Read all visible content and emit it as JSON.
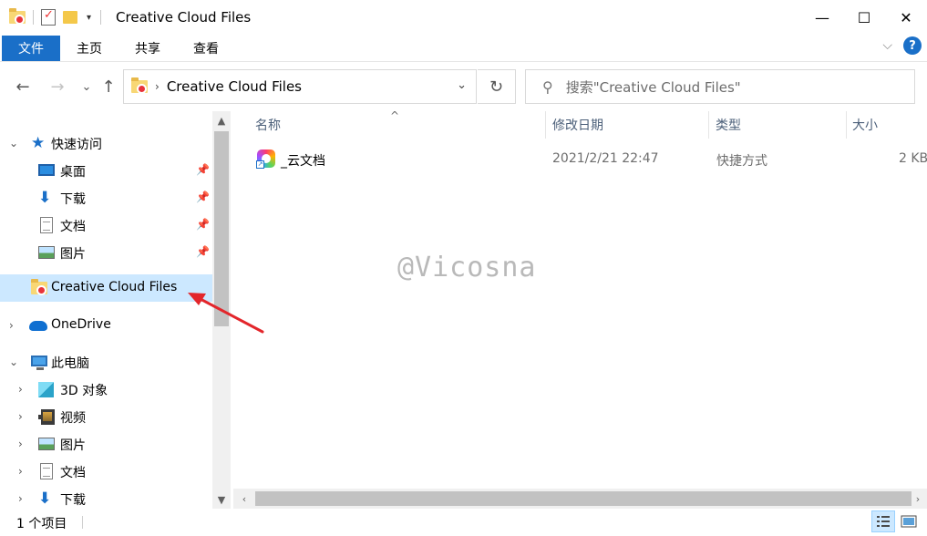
{
  "window": {
    "title": "Creative Cloud Files",
    "minimize_glyph": "—",
    "maximize_glyph": "☐",
    "close_glyph": "✕",
    "qat_dropdown_glyph": "▾"
  },
  "ribbon": {
    "tabs": [
      "文件",
      "主页",
      "共享",
      "查看"
    ],
    "help_glyph": "?",
    "collapse_glyph": "⌵"
  },
  "nav": {
    "back_glyph": "←",
    "forward_glyph": "→",
    "recent_glyph": "⌄",
    "up_glyph": "↑",
    "refresh_glyph": "↻",
    "address_chevron": "›",
    "address_dropdown": "⌄",
    "address_path": "Creative Cloud Files",
    "search_placeholder": "搜索\"Creative Cloud Files\"",
    "search_icon": "⚲"
  },
  "navpane": {
    "quick_access": {
      "label": "快速访问",
      "items": [
        {
          "label": "桌面",
          "icon": "desktop-icon"
        },
        {
          "label": "下载",
          "icon": "download-icon"
        },
        {
          "label": "文档",
          "icon": "documents-icon"
        },
        {
          "label": "图片",
          "icon": "pictures-icon"
        }
      ]
    },
    "creative_cloud": "Creative Cloud Files",
    "onedrive": "OneDrive",
    "this_pc": {
      "label": "此电脑",
      "items": [
        {
          "label": "3D 对象",
          "icon": "3d-objects-icon"
        },
        {
          "label": "视频",
          "icon": "videos-icon"
        },
        {
          "label": "图片",
          "icon": "pictures-icon"
        },
        {
          "label": "文档",
          "icon": "documents-icon"
        },
        {
          "label": "下载",
          "icon": "download-icon"
        }
      ]
    },
    "pin_glyph": "📌",
    "expanded_glyph": "⌄",
    "collapsed_glyph": "›",
    "scroll_up": "▲",
    "scroll_down": "▼"
  },
  "columns": {
    "name": "名称",
    "modified": "修改日期",
    "type": "类型",
    "size": "大小",
    "sort_glyph": "^"
  },
  "files": [
    {
      "name": "_云文档",
      "modified": "2021/2/21 22:47",
      "type": "快捷方式",
      "size": "2 KB"
    }
  ],
  "watermark": "@Vicosna",
  "status": {
    "item_count": "1 个项目"
  },
  "hscroll": {
    "left": "‹",
    "right": "›"
  },
  "colors": {
    "accent": "#1a6fc8",
    "selection": "#cce8ff",
    "annotation_arrow": "#e3262b"
  }
}
